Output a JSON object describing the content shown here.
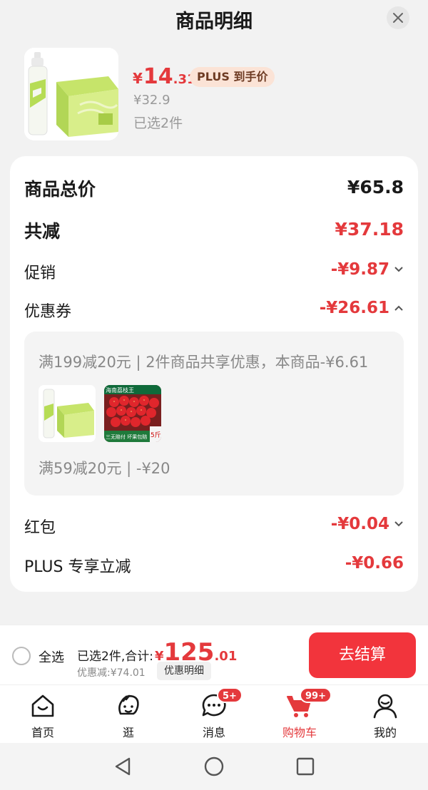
{
  "header": {
    "title": "商品明细",
    "close_icon": "close-icon"
  },
  "product": {
    "price_symbol": "¥",
    "price_integer": "14",
    "price_decimal": ".31",
    "plus_tag": "PLUS 到手价",
    "original_price": "¥32.9",
    "selected_count": "已选2件"
  },
  "breakdown": {
    "total_label": "商品总价",
    "total_value": "¥65.8",
    "reduce_label": "共减",
    "reduce_value": "¥37.18",
    "promo_label": "促销",
    "promo_value": "-¥9.87",
    "coupon_label": "优惠券",
    "coupon_value": "-¥26.61",
    "coupon_detail": {
      "line1": "满199减20元 | 2件商品共享优惠，本商品-¥6.61",
      "strawberry_title": "海南荔枝王",
      "strawberry_weight": "5斤",
      "strawberry_footer": "三无赔付 坏果包赔",
      "line2": "满59减20元 | -¥20"
    },
    "redpacket_label": "红包",
    "redpacket_value": "-¥0.04",
    "plus_label": "PLUS 专享立减",
    "plus_value": "-¥0.66"
  },
  "bottom_bar": {
    "select_all": "全选",
    "total_prefix": "已选2件,合计:",
    "total_symbol": "¥",
    "total_integer": "125",
    "total_decimal": ".01",
    "saving_text": "优惠减:¥74.01",
    "saving_button": "优惠明细",
    "checkout": "去结算"
  },
  "tabbar": {
    "tabs": [
      {
        "label": "首页",
        "icon": "home-icon"
      },
      {
        "label": "逛",
        "icon": "stroll-icon"
      },
      {
        "label": "消息",
        "icon": "message-icon",
        "badge": "5+"
      },
      {
        "label": "购物车",
        "icon": "cart-icon",
        "badge": "99+",
        "active": true
      },
      {
        "label": "我的",
        "icon": "profile-icon"
      }
    ]
  },
  "colors": {
    "accent": "#e4393c",
    "checkout": "#f2343c",
    "plus_tag_bg": "#fbe3d6"
  }
}
